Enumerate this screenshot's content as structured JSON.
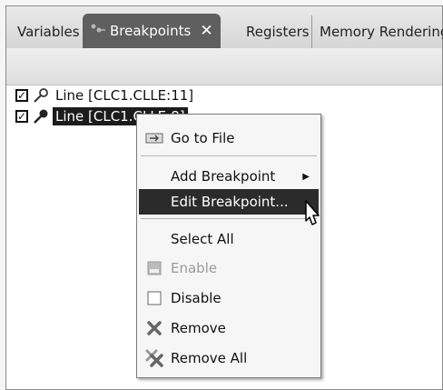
{
  "tabs": [
    {
      "label": "Variables"
    },
    {
      "label": "Breakpoints",
      "close": "✕"
    },
    {
      "label": "Registers"
    },
    {
      "label": "Memory Rendering"
    }
  ],
  "breakpoints": [
    {
      "label": "Line [CLC1.CLLE:11]",
      "checked": "✓"
    },
    {
      "label": "Line [CLC1.CLLE:8]",
      "checked": "✓"
    }
  ],
  "context_menu": {
    "go_to_file": "Go to File",
    "add_breakpoint": "Add Breakpoint",
    "add_breakpoint_arrow": "▶",
    "edit_breakpoint": "Edit Breakpoint...",
    "select_all": "Select All",
    "enable": "Enable",
    "disable": "Disable",
    "remove": "Remove",
    "remove_all": "Remove All"
  },
  "colors": {
    "highlight": "#2b2b2b",
    "active_tab": "#5f5f5f",
    "disabled_text": "#9a9a9a"
  }
}
